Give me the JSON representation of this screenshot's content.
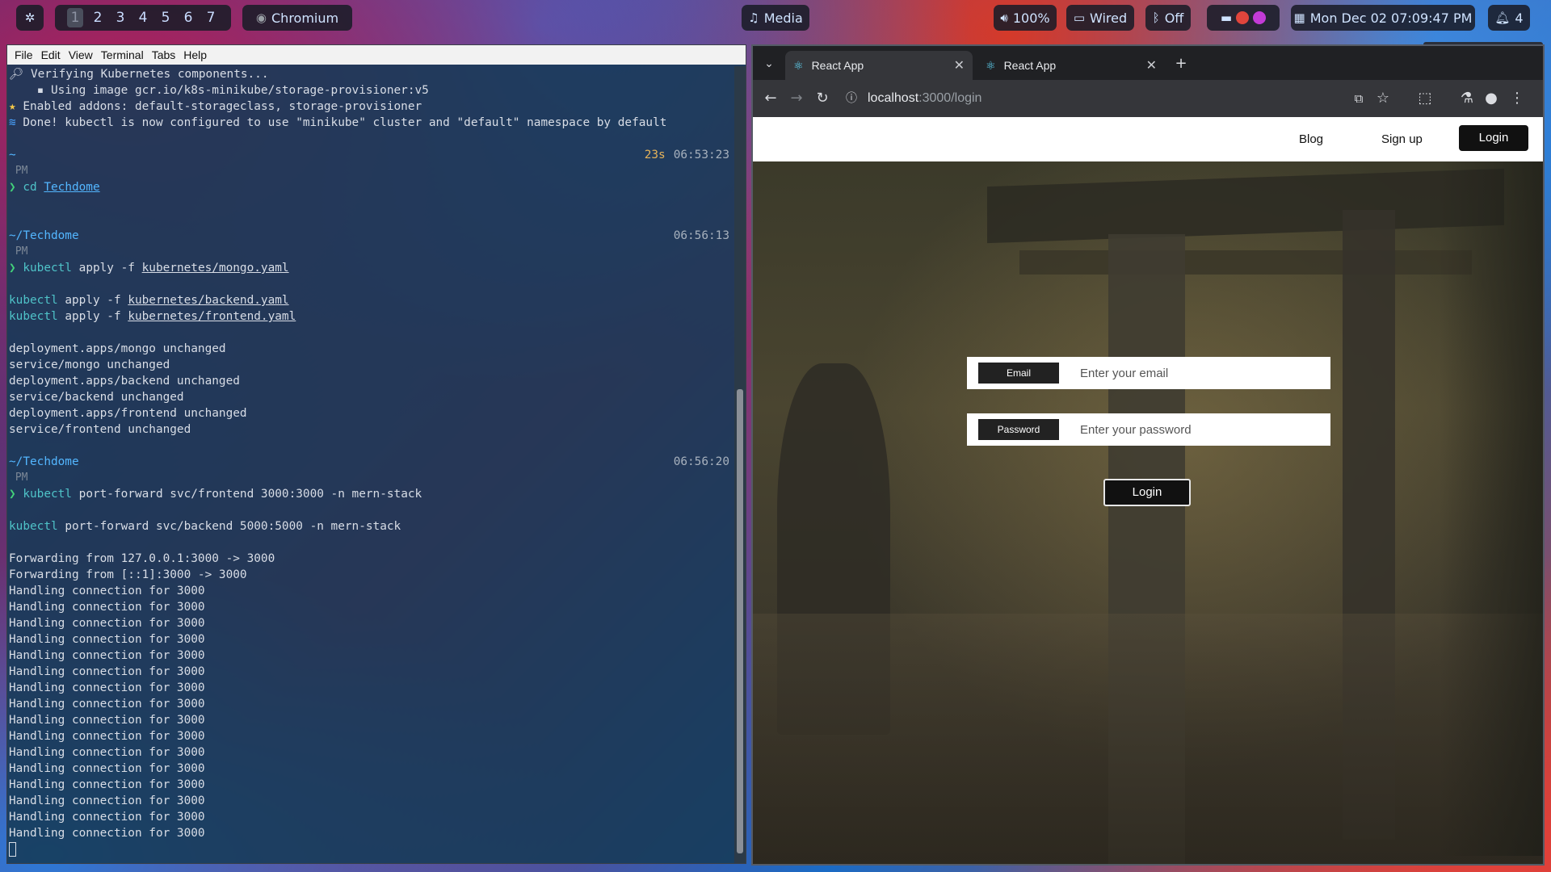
{
  "topbar": {
    "workspaces": [
      "1",
      "2",
      "3",
      "4",
      "5",
      "6",
      "7"
    ],
    "active_workspace": "1",
    "focused_app": "Chromium",
    "media_label": "Media",
    "volume": "100%",
    "network": "Wired",
    "bluetooth": "Off",
    "datetime": "Mon Dec 02  07:09:47 PM",
    "notification_count": "4"
  },
  "terminal": {
    "menu": [
      "File",
      "Edit",
      "View",
      "Terminal",
      "Tabs",
      "Help"
    ],
    "lines": {
      "l1": "Verifying Kubernetes components...",
      "l2": "▪ Using image gcr.io/k8s-minikube/storage-provisioner:v5",
      "l3": "Enabled addons: default-storageclass, storage-provisioner",
      "l4": "Done! kubectl is now configured to use \"minikube\" cluster and \"default\" namespace by default",
      "p1_dir": "~",
      "p1_dur": "23s",
      "p1_time": "06:53:23",
      "pm": "PM",
      "p1_cmd": "cd",
      "p1_arg": "Techdome",
      "p2_dir": "~/Techdome",
      "p2_time": "06:56:13",
      "p2_cmd": "kubectl",
      "p2_rest": "apply -f ",
      "p2_file": "kubernetes/mongo.yaml",
      "c2a_cmd": "kubectl",
      "c2a_rest": "apply -f ",
      "c2a_file": "kubernetes/backend.yaml",
      "c2b_cmd": "kubectl",
      "c2b_rest": "apply -f ",
      "c2b_file": "kubernetes/frontend.yaml",
      "o1": "deployment.apps/mongo unchanged",
      "o2": "service/mongo unchanged",
      "o3": "deployment.apps/backend unchanged",
      "o4": "service/backend unchanged",
      "o5": "deployment.apps/frontend unchanged",
      "o6": "service/frontend unchanged",
      "p3_dir": "~/Techdome",
      "p3_time": "06:56:20",
      "p3_cmd": "kubectl",
      "p3_rest": "port-forward svc/frontend 3000:3000 -n mern-stack",
      "c3_cmd": "kubectl",
      "c3_rest": "port-forward svc/backend 5000:5000 -n mern-stack",
      "f1": "Forwarding from 127.0.0.1:3000 -> 3000",
      "f2": "Forwarding from [::1]:3000 -> 3000",
      "h": "Handling connection for 3000"
    }
  },
  "browser": {
    "tabs": [
      {
        "title": "React App"
      },
      {
        "title": "React App"
      }
    ],
    "url_host": "localhost",
    "url_path": ":3000/login",
    "page": {
      "nav": {
        "blog": "Blog",
        "signup": "Sign up",
        "login": "Login"
      },
      "email_label": "Email",
      "email_placeholder": "Enter your email",
      "password_label": "Password",
      "password_placeholder": "Enter your password",
      "submit_label": "Login"
    }
  },
  "colors": {
    "terminal_bg": "#163a56",
    "prompt_green": "#43d17a",
    "dir_blue": "#53b6ff",
    "cmd_cyan": "#4fc3c8",
    "chrome_dark": "#202124",
    "chrome_toolbar": "#35363a"
  }
}
